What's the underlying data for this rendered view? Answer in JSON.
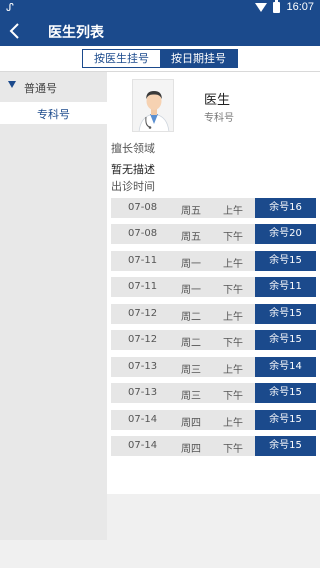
{
  "status_bar": {
    "left_icon": "bug-icon",
    "time": "16:07"
  },
  "app_bar": {
    "title": "医生列表",
    "back_icon": "chevron-left-icon"
  },
  "tabs": [
    {
      "label": "按医生挂号",
      "active": true
    },
    {
      "label": "按日期挂号",
      "active": false
    }
  ],
  "sidebar": {
    "group_label": "普通号",
    "items": [
      {
        "label": "专科号",
        "selected": true
      }
    ]
  },
  "doctor": {
    "name": "医生",
    "title": "专科号",
    "specialty_label": "擅长领域",
    "specialty_value": "暂无描述",
    "schedule_label": "出诊时间"
  },
  "schedule": [
    {
      "date": "07-08",
      "day": "周五",
      "period": "上午",
      "slot": "余号16"
    },
    {
      "date": "07-08",
      "day": "周五",
      "period": "下午",
      "slot": "余号20"
    },
    {
      "date": "07-11",
      "day": "周一",
      "period": "上午",
      "slot": "余号15"
    },
    {
      "date": "07-11",
      "day": "周一",
      "period": "下午",
      "slot": "余号11"
    },
    {
      "date": "07-12",
      "day": "周二",
      "period": "上午",
      "slot": "余号15"
    },
    {
      "date": "07-12",
      "day": "周二",
      "period": "下午",
      "slot": "余号15"
    },
    {
      "date": "07-13",
      "day": "周三",
      "period": "上午",
      "slot": "余号14"
    },
    {
      "date": "07-13",
      "day": "周三",
      "period": "下午",
      "slot": "余号15"
    },
    {
      "date": "07-14",
      "day": "周四",
      "period": "上午",
      "slot": "余号15"
    },
    {
      "date": "07-14",
      "day": "周四",
      "period": "下午",
      "slot": "余号15"
    }
  ],
  "colors": {
    "primary": "#1b4a8c",
    "row_bg": "#e6e6e6",
    "background": "#f0f0f0"
  }
}
